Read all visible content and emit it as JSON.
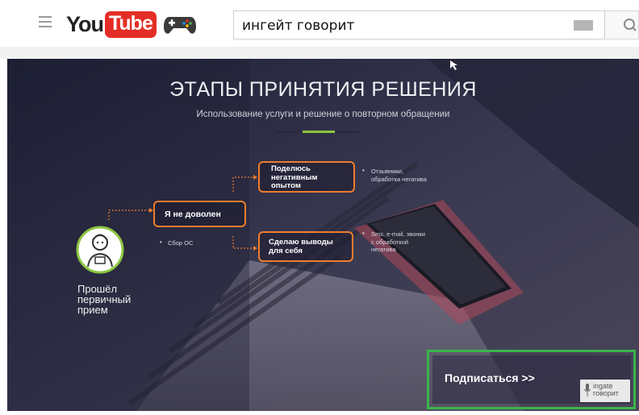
{
  "youtube": {
    "logo_you": "You",
    "logo_tube": "Tube",
    "search": {
      "value": "ингейт говорит"
    }
  },
  "video": {
    "title": "ЭТАПЫ ПРИНЯТИЯ РЕШЕНИЯ",
    "subtitle": "Использование услуги и решение о повторном обращении",
    "stages": {
      "visited": "Прошёл\nпервичный\nприем",
      "unsatisfied": "Я не доволен",
      "share": "Поделюсь\nнегативным\nопытом",
      "conclusions": "Сделаю выводы\nдля себя"
    },
    "notes": {
      "feedback": "Сбор ОС",
      "reviews": "Отзывники,\nобработка негатива",
      "calls": "Sms, e-mail, звонки\nс обработкой\nнегатива"
    },
    "subscribe_label": "Подписаться >>",
    "brand_logo": "ingate\nговорит"
  },
  "colors": {
    "accent_orange": "#f07d2a",
    "accent_green": "#8cc63f",
    "subscribe_frame": "#39b54a",
    "youtube_red": "#e52d27"
  }
}
